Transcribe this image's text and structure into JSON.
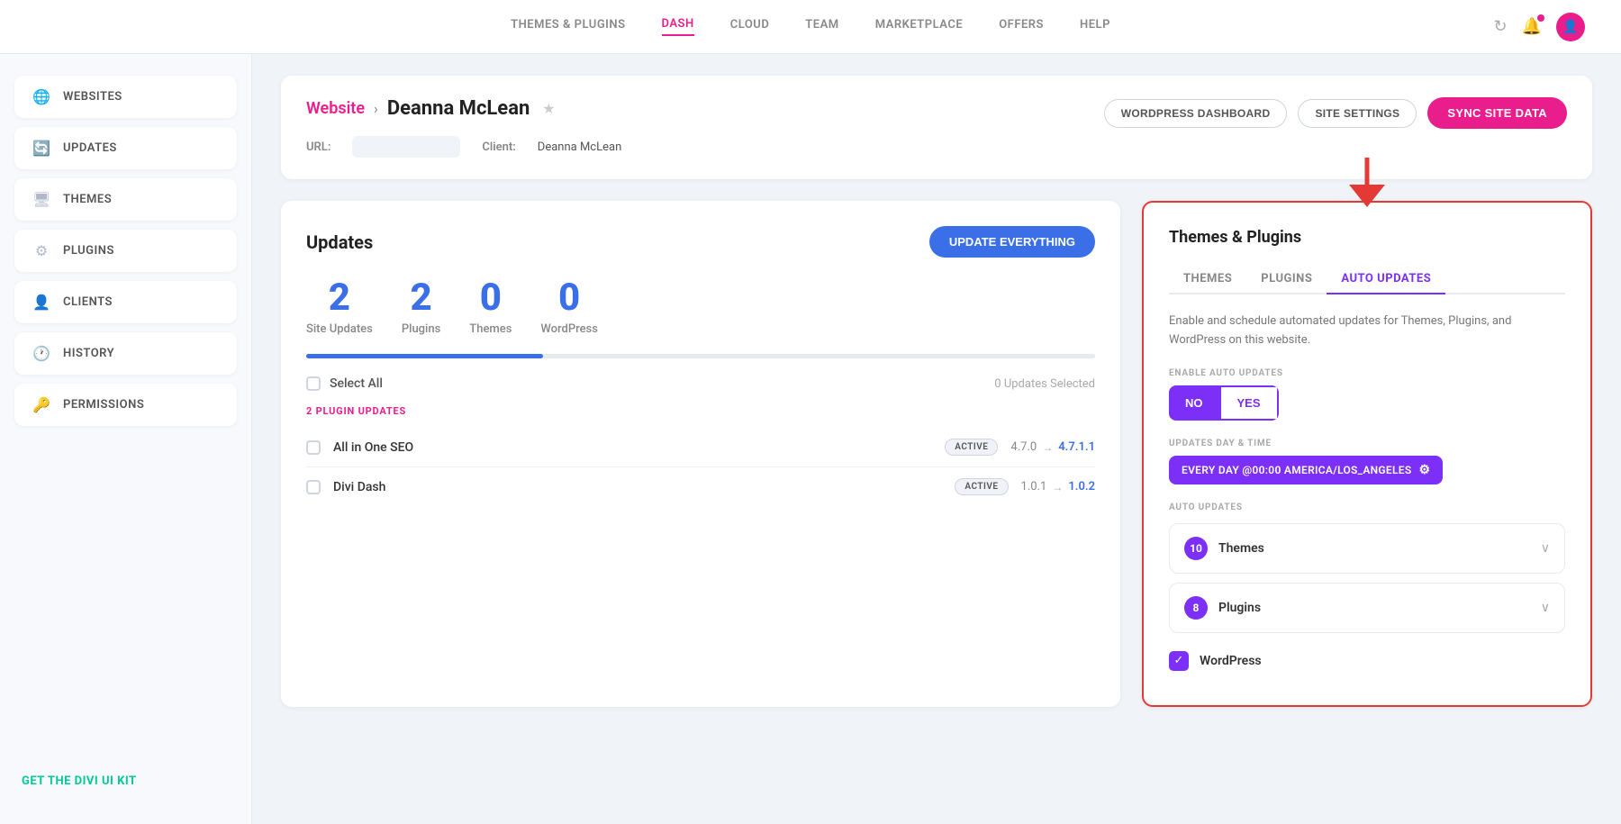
{
  "nav": {
    "links": [
      {
        "id": "themes-plugins",
        "label": "THEMES & PLUGINS",
        "active": false
      },
      {
        "id": "dash",
        "label": "DASH",
        "active": true
      },
      {
        "id": "cloud",
        "label": "CLOUD",
        "active": false
      },
      {
        "id": "team",
        "label": "TEAM",
        "active": false
      },
      {
        "id": "marketplace",
        "label": "MARKETPLACE",
        "active": false
      },
      {
        "id": "offers",
        "label": "OFFERS",
        "active": false
      },
      {
        "id": "help",
        "label": "HELP",
        "active": false
      }
    ]
  },
  "sidebar": {
    "items": [
      {
        "id": "websites",
        "label": "WEBSITES",
        "icon": "🌐"
      },
      {
        "id": "updates",
        "label": "UPDATES",
        "icon": "🔄"
      },
      {
        "id": "themes",
        "label": "THEMES",
        "icon": "🖥"
      },
      {
        "id": "plugins",
        "label": "PLUGINS",
        "icon": "⚙"
      },
      {
        "id": "clients",
        "label": "CLIENTS",
        "icon": "👤"
      },
      {
        "id": "history",
        "label": "HISTORY",
        "icon": "🕐"
      },
      {
        "id": "permissions",
        "label": "PERMISSIONS",
        "icon": "🔑"
      }
    ],
    "get_kit_label": "GET THE DIVI UI KIT"
  },
  "header": {
    "breadcrumb_website": "Website",
    "breadcrumb_separator": "›",
    "page_title": "Deanna McLean",
    "star": "★",
    "url_label": "URL:",
    "url_value": "██████████",
    "client_label": "Client:",
    "client_value": "Deanna McLean",
    "btn_wordpress_dashboard": "WORDPRESS DASHBOARD",
    "btn_site_settings": "SITE SETTINGS",
    "btn_sync": "SYNC SITE DATA"
  },
  "updates": {
    "title": "Updates",
    "btn_update_everything": "UPDATE EVERYTHING",
    "stats": [
      {
        "number": "2",
        "label": "Site Updates"
      },
      {
        "number": "2",
        "label": "Plugins"
      },
      {
        "number": "0",
        "label": "Themes"
      },
      {
        "number": "0",
        "label": "WordPress"
      }
    ],
    "select_all_label": "Select All",
    "updates_selected": "0 Updates Selected",
    "section_label": "2 PLUGIN UPDATES",
    "plugins": [
      {
        "name": "All in One SEO",
        "status": "ACTIVE",
        "version_from": "4.7.0",
        "version_to": "4.7.1.1"
      },
      {
        "name": "Divi Dash",
        "status": "ACTIVE",
        "version_from": "1.0.1",
        "version_to": "1.0.2"
      }
    ]
  },
  "themes_plugins_panel": {
    "title": "Themes & Plugins",
    "tabs": [
      {
        "id": "themes",
        "label": "THEMES",
        "active": false
      },
      {
        "id": "plugins",
        "label": "PLUGINS",
        "active": false
      },
      {
        "id": "auto-updates",
        "label": "AUTO UPDATES",
        "active": true
      }
    ],
    "description": "Enable and schedule automated updates for Themes, Plugins, and WordPress on this website.",
    "enable_label": "ENABLE AUTO UPDATES",
    "toggle_no": "NO",
    "toggle_yes": "YES",
    "updates_day_time_label": "UPDATES DAY & TIME",
    "schedule_value": "EVERY DAY @00:00 AMERICA/LOS_ANGELES",
    "auto_updates_label": "AUTO UPDATES",
    "accordion_items": [
      {
        "count": "10",
        "label": "Themes"
      },
      {
        "count": "8",
        "label": "Plugins"
      }
    ],
    "wordpress_label": "WordPress"
  }
}
